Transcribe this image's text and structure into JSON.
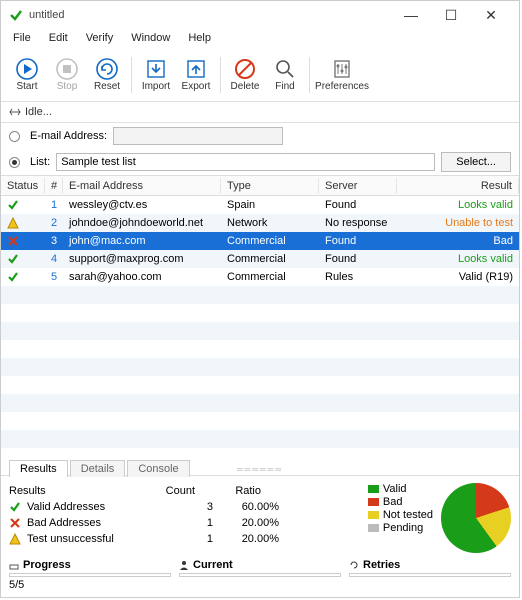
{
  "window": {
    "title": "untitled"
  },
  "menu": {
    "file": "File",
    "edit": "Edit",
    "verify": "Verify",
    "window": "Window",
    "help": "Help"
  },
  "toolbar": {
    "start": "Start",
    "stop": "Stop",
    "reset": "Reset",
    "import": "Import",
    "export": "Export",
    "delete": "Delete",
    "find": "Find",
    "prefs": "Preferences"
  },
  "status_idle": "Idle...",
  "input": {
    "email_label": "E-mail Address:",
    "list_label": "List:",
    "list_value": "Sample test list",
    "select_btn": "Select..."
  },
  "columns": {
    "status": "Status",
    "num": "#",
    "email": "E-mail Address",
    "type": "Type",
    "server": "Server",
    "result": "Result"
  },
  "rows": [
    {
      "n": "1",
      "email": "wessley@ctv.es",
      "type": "Spain",
      "server": "Found",
      "result": "Looks valid",
      "rclass": "looksvalid",
      "icon": "check"
    },
    {
      "n": "2",
      "email": "johndoe@johndoeworld.net",
      "type": "Network",
      "server": "No response",
      "result": "Unable to test",
      "rclass": "unable",
      "icon": "warn"
    },
    {
      "n": "3",
      "email": "john@mac.com",
      "type": "Commercial",
      "server": "Found",
      "result": "Bad",
      "rclass": "bad",
      "icon": "x",
      "selected": true
    },
    {
      "n": "4",
      "email": "support@maxprog.com",
      "type": "Commercial",
      "server": "Found",
      "result": "Looks valid",
      "rclass": "looksvalid",
      "icon": "check"
    },
    {
      "n": "5",
      "email": "sarah@yahoo.com",
      "type": "Commercial",
      "server": "Rules",
      "result": "Valid (R19)",
      "rclass": "",
      "icon": "check"
    }
  ],
  "tabs": {
    "results": "Results",
    "details": "Details",
    "console": "Console"
  },
  "summary": {
    "title": "Results",
    "count_h": "Count",
    "ratio_h": "Ratio",
    "valid_label": "Valid Addresses",
    "valid_count": "3",
    "valid_ratio": "60.00%",
    "bad_label": "Bad Addresses",
    "bad_count": "1",
    "bad_ratio": "20.00%",
    "test_label": "Test unsuccessful",
    "test_count": "1",
    "test_ratio": "20.00%"
  },
  "legend": {
    "valid": "Valid",
    "bad": "Bad",
    "nottested": "Not tested",
    "pending": "Pending"
  },
  "progress": {
    "h": "Progress",
    "v": "5/5",
    "cur_h": "Current",
    "cur_v": "",
    "ret_h": "Retries",
    "ret_v": ""
  },
  "chart_data": {
    "type": "pie",
    "title": "Results",
    "series": [
      {
        "name": "Valid",
        "value": 3,
        "ratio": 60.0,
        "color": "#1a9e1a"
      },
      {
        "name": "Bad",
        "value": 1,
        "ratio": 20.0,
        "color": "#d43a1a"
      },
      {
        "name": "Not tested",
        "value": 1,
        "ratio": 20.0,
        "color": "#e8d023"
      },
      {
        "name": "Pending",
        "value": 0,
        "ratio": 0.0,
        "color": "#bbbbbb"
      }
    ]
  }
}
